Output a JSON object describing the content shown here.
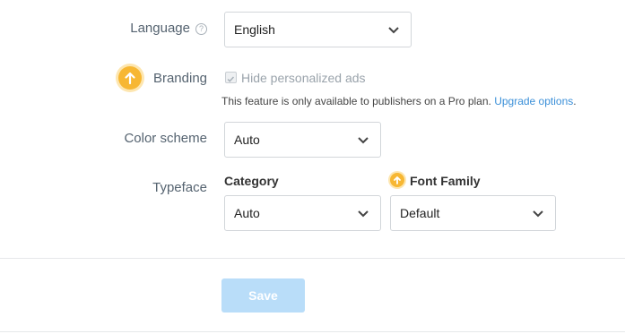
{
  "language": {
    "label": "Language",
    "help": "?",
    "value": "English"
  },
  "branding": {
    "label": "Branding",
    "checkbox_label": "Hide personalized ads",
    "checked": true,
    "note": "This feature is only available to publishers on a Pro plan.",
    "note_link": "Upgrade options"
  },
  "color_scheme": {
    "label": "Color scheme",
    "value": "Auto"
  },
  "typeface": {
    "label": "Typeface",
    "category": {
      "label": "Category",
      "value": "Auto"
    },
    "font_family": {
      "label": "Font Family",
      "value": "Default"
    }
  },
  "save_label": "Save",
  "colors": {
    "accent": "#3a8fd8",
    "upgrade": "#f7b733",
    "save_disabled": "#b9ddf9"
  },
  "icons": [
    "help-icon",
    "upgrade-arrow-icon",
    "chevron-down-icon",
    "checkbox-icon"
  ]
}
